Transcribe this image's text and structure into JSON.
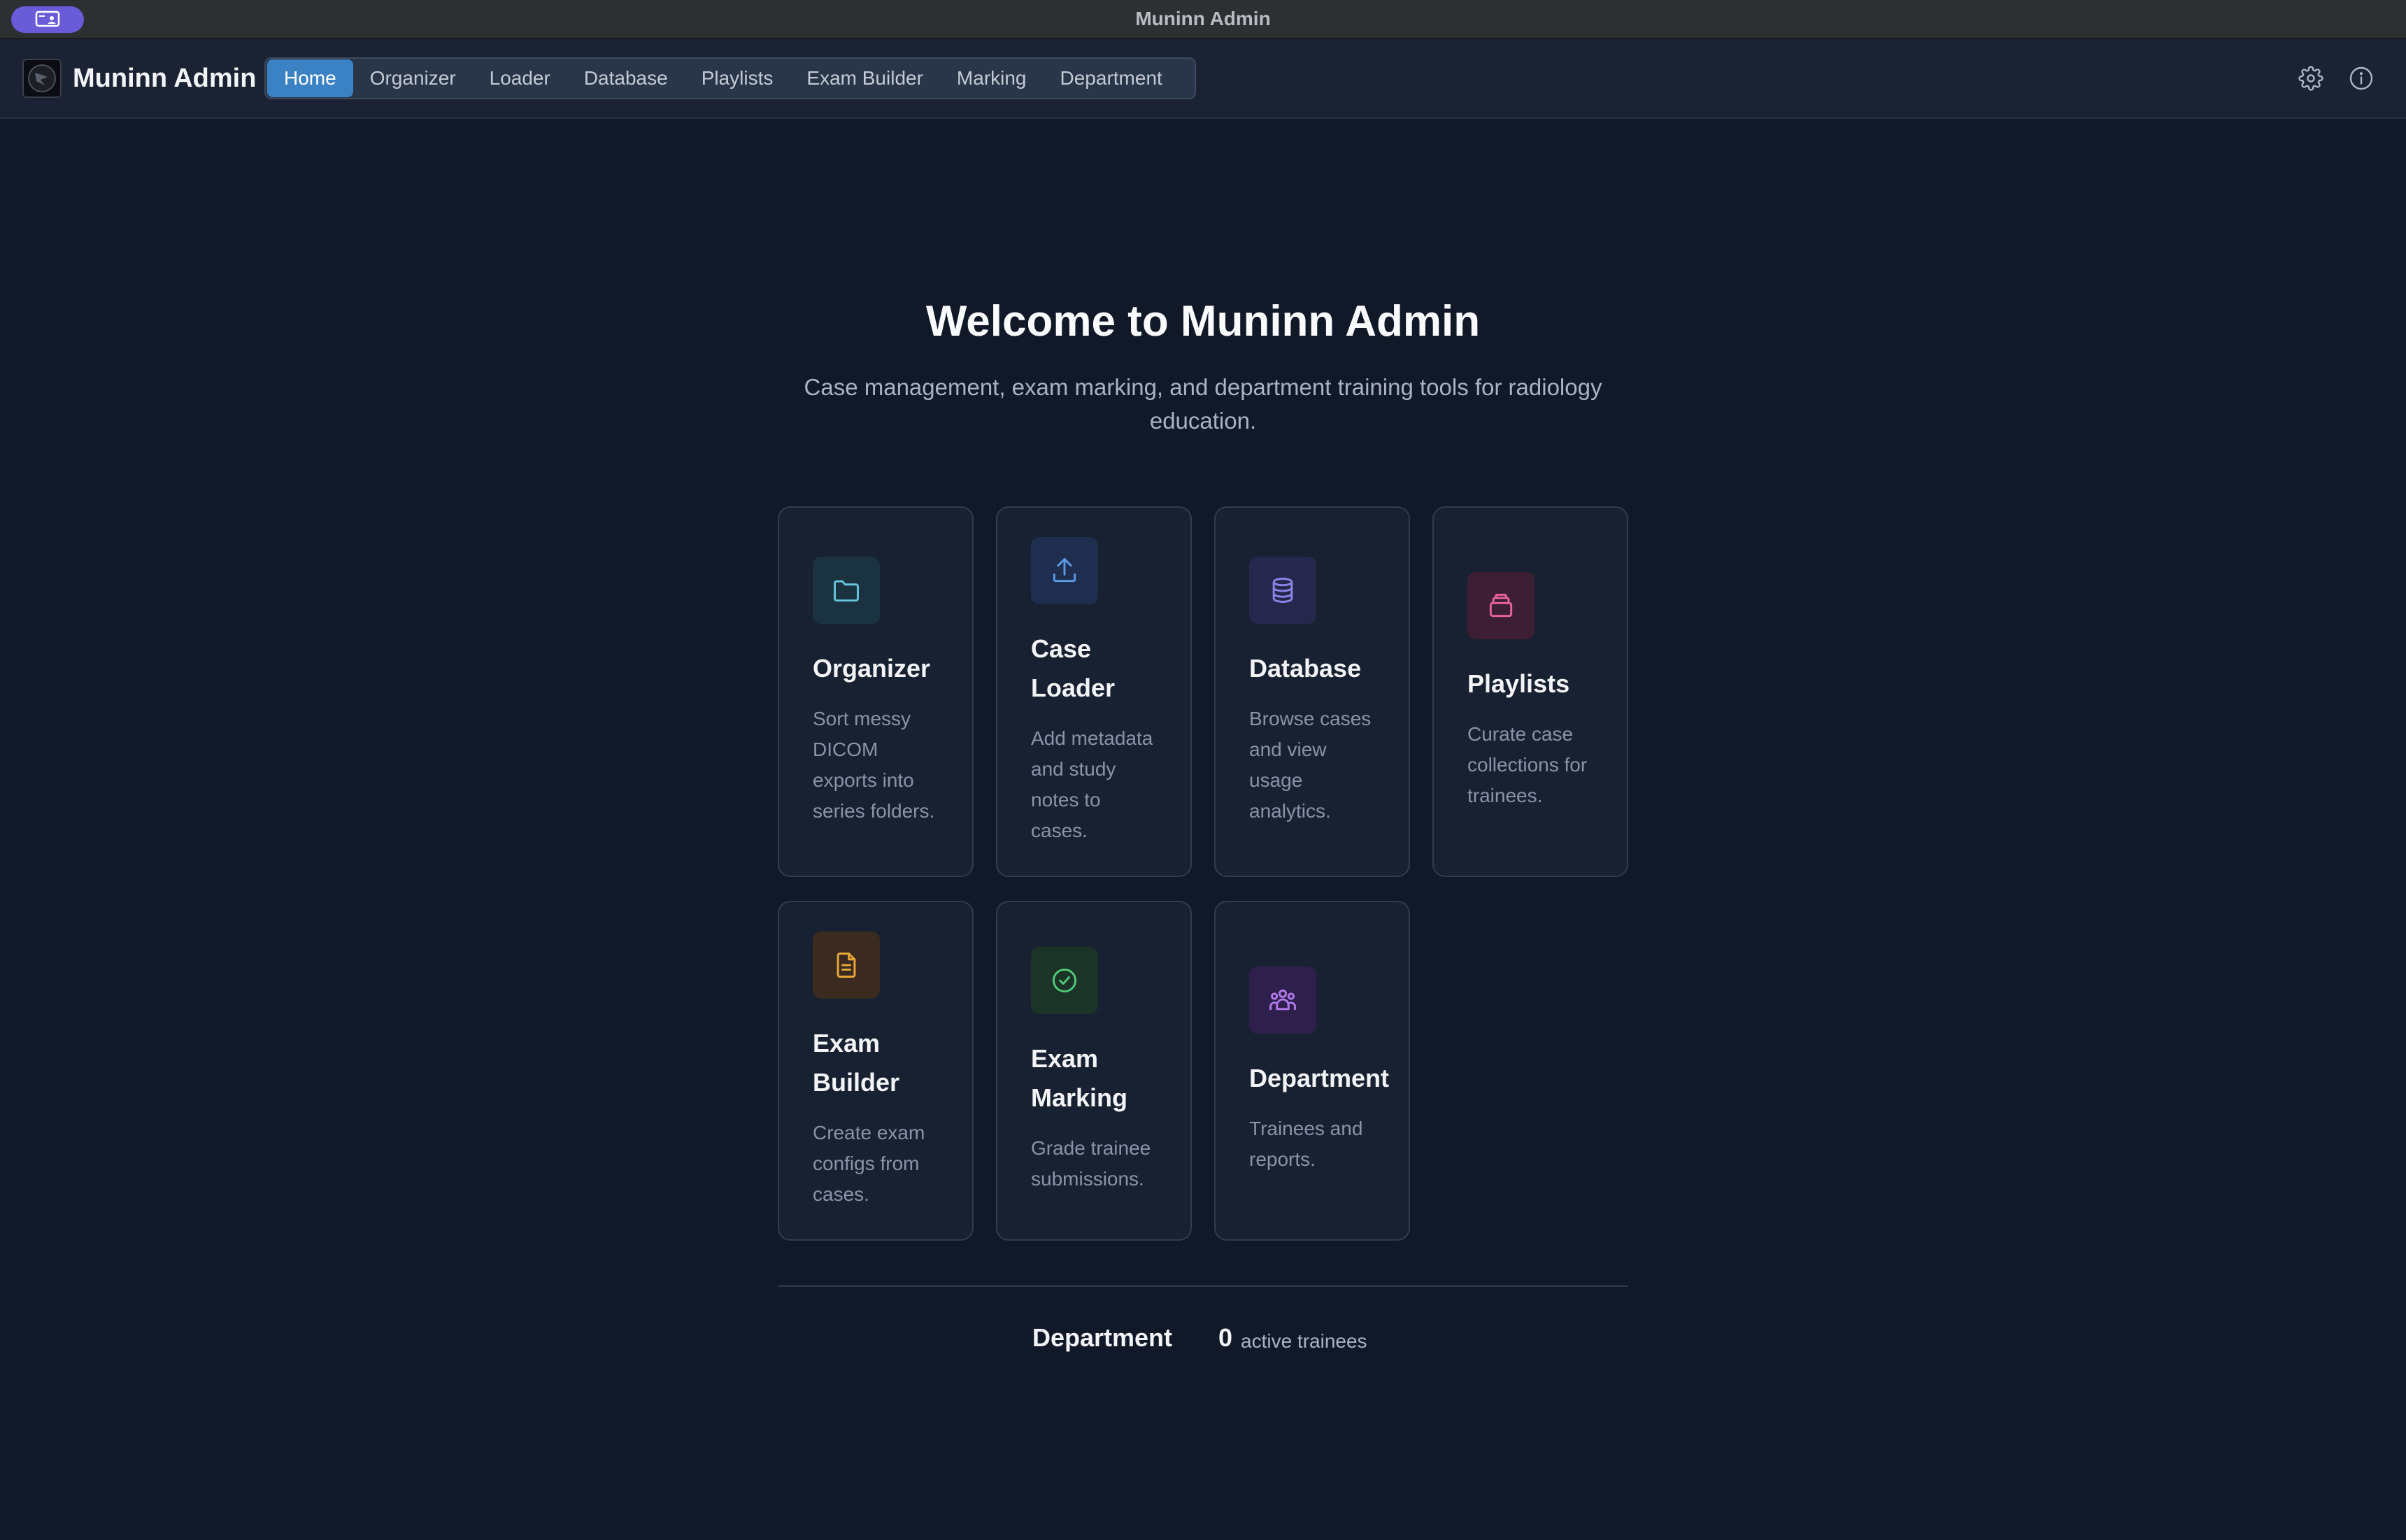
{
  "window": {
    "title": "Muninn Admin"
  },
  "header": {
    "brand": "Muninn Admin",
    "nav": [
      "Home",
      "Organizer",
      "Loader",
      "Database",
      "Playlists",
      "Exam Builder",
      "Marking",
      "Department"
    ],
    "active_nav": "Home",
    "icons": [
      "settings-icon",
      "info-icon"
    ]
  },
  "main": {
    "title": "Welcome to Muninn Admin",
    "subtitle": "Case management, exam marking, and department training tools for radiology education.",
    "cards": [
      {
        "title": "Organizer",
        "desc": "Sort messy DICOM exports into series folders.",
        "icon": "folder-icon",
        "color": "#67c5e0"
      },
      {
        "title": "Case Loader",
        "desc": "Add metadata and study notes to cases.",
        "icon": "upload-icon",
        "color": "#5b9be8"
      },
      {
        "title": "Database",
        "desc": "Browse cases and view usage analytics.",
        "icon": "database-icon",
        "color": "#8b86e8"
      },
      {
        "title": "Playlists",
        "desc": "Curate case collections for trainees.",
        "icon": "archive-icon",
        "color": "#e8639a"
      },
      {
        "title": "Exam Builder",
        "desc": "Create exam configs from cases.",
        "icon": "document-icon",
        "color": "#e8a838"
      },
      {
        "title": "Exam Marking",
        "desc": "Grade trainee submissions.",
        "icon": "check-circle-icon",
        "color": "#4fc878"
      },
      {
        "title": "Department",
        "desc": "Trainees and reports.",
        "icon": "users-icon",
        "color": "#b07ae8"
      }
    ]
  },
  "footer_stats": {
    "label": "Department",
    "value": "0",
    "unit": "active trainees"
  }
}
